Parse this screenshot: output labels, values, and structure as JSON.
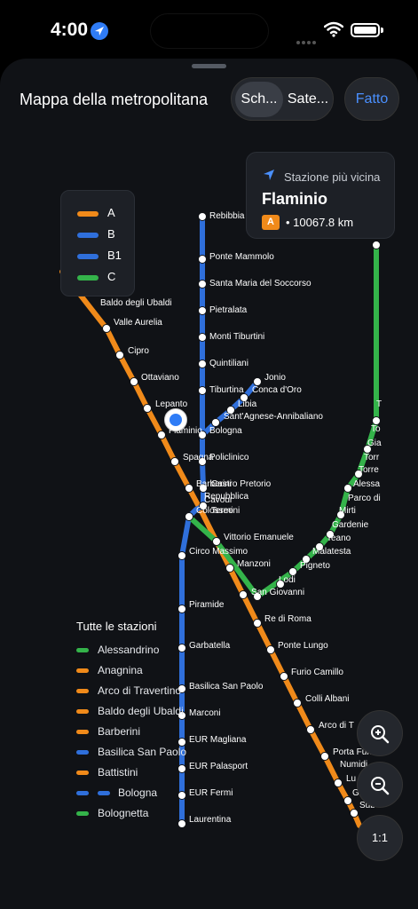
{
  "status": {
    "time": "4:00"
  },
  "header": {
    "title": "Mappa della metropolitana",
    "segments": [
      "Sch...",
      "Sate..."
    ],
    "done_label": "Fatto"
  },
  "legend": [
    {
      "label": "A",
      "color": "#f08a1a"
    },
    {
      "label": "B",
      "color": "#2f6fdb"
    },
    {
      "label": "B1",
      "color": "#2f6fdb"
    },
    {
      "label": "C",
      "color": "#34b34a"
    }
  ],
  "nearest": {
    "header": "Stazione più vicina",
    "name": "Flaminio",
    "line": "A",
    "distance": "• 10067.8 km"
  },
  "map_labels": {
    "rebibbia": "Rebibbia",
    "ponte_mammolo": "Ponte Mammolo",
    "santa_maria": "Santa Maria del Soccorso",
    "pietralata": "Pietralata",
    "monti_tiburtini": "Monti Tiburtini",
    "quintiliani": "Quintiliani",
    "tiburtina": "Tiburtina",
    "jonio": "Jonio",
    "conca_oro": "Conca d'Oro",
    "libia": "Libia",
    "santagnese": "Sant'Agnese-Annibaliano",
    "bologna": "Bologna",
    "policlinico": "Policlinico",
    "castro_pretorio": "Castro Pretorio",
    "repubblica": "Repubblica",
    "barberini": "Barberini",
    "cavour": "Cavour",
    "termini": "Termini",
    "colosseo": "Colosseo",
    "vittorio": "Vittorio Emanuele",
    "manzoni": "Manzoni",
    "circo_massimo": "Circo Massimo",
    "piramide": "Piramide",
    "garbatella": "Garbatella",
    "basilica_sp": "Basilica San Paolo",
    "marconi": "Marconi",
    "eur_magliana": "EUR Magliana",
    "eur_palasport": "EUR Palasport",
    "eur_fermi": "EUR Fermi",
    "laurentina": "Laurentina",
    "baldo": "Baldo degli Ubaldi",
    "valle_aurelia": "Valle Aurelia",
    "cipro": "Cipro",
    "ottaviano": "Ottaviano",
    "lepanto": "Lepanto",
    "flaminio": "Flaminio",
    "spagna": "Spagna",
    "san_giovanni": "San Giovanni",
    "re_di_roma": "Re di Roma",
    "ponte_lungo": "Ponte Lungo",
    "furio_camillo": "Furio Camillo",
    "colli_albani": "Colli Albani",
    "arco_di_t": "Arco di T",
    "porta_furba": "Porta Furb",
    "numidio": "Numidi",
    "lu": "Lu",
    "g": "G",
    "subaugusta": "Sub",
    "lodi": "Lodi",
    "pigneto": "Pigneto",
    "malatesta": "Malatesta",
    "teano": "Teano",
    "gardenie": "Gardenie",
    "mirti": "Mirti",
    "parco": "Parco di",
    "alessandrino_m": "Alessa",
    "torre1": "Torre",
    "torre2": "Torr",
    "gia": "Gia",
    "to": "To",
    "t": "T"
  },
  "all_stations": {
    "title": "Tutte le stazioni",
    "items": [
      {
        "label": "Alessandrino",
        "colors": [
          "#34b34a"
        ]
      },
      {
        "label": "Anagnina",
        "colors": [
          "#f08a1a"
        ]
      },
      {
        "label": "Arco di Travertino",
        "colors": [
          "#f08a1a"
        ]
      },
      {
        "label": "Baldo degli Ubaldi",
        "colors": [
          "#f08a1a"
        ]
      },
      {
        "label": "Barberini",
        "colors": [
          "#f08a1a"
        ]
      },
      {
        "label": "Basilica San Paolo",
        "colors": [
          "#2f6fdb"
        ]
      },
      {
        "label": "Battistini",
        "colors": [
          "#f08a1a"
        ]
      },
      {
        "label": "Bologna",
        "colors": [
          "#2f6fdb",
          "#2f6fdb"
        ]
      },
      {
        "label": "Bolognetta",
        "colors": [
          "#34b34a"
        ]
      }
    ]
  },
  "zoom": {
    "in_icon": "zoom-in-icon",
    "out_icon": "zoom-out-icon",
    "reset_label": "1:1"
  }
}
